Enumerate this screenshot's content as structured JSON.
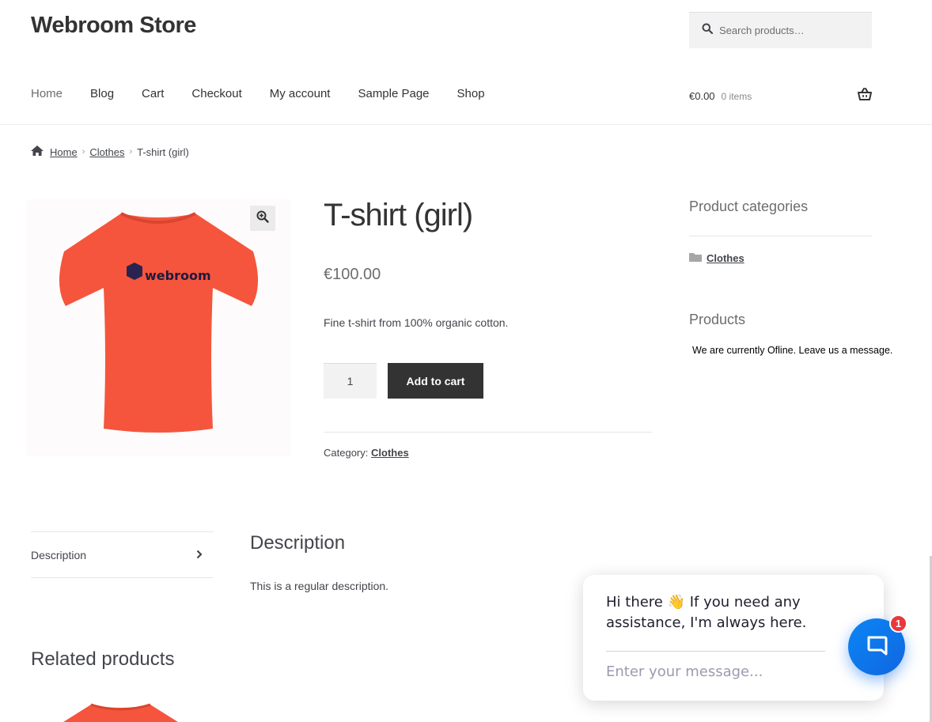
{
  "header": {
    "site_title": "Webroom Store",
    "search_placeholder": "Search products…",
    "nav": [
      "Home",
      "Blog",
      "Cart",
      "Checkout",
      "My account",
      "Sample Page",
      "Shop"
    ],
    "cart_amount": "€0.00",
    "cart_count": "0 items"
  },
  "breadcrumb": {
    "home": "Home",
    "category": "Clothes",
    "current": "T-shirt (girl)"
  },
  "product": {
    "image_brand": "webroom",
    "title": "T-shirt (girl)",
    "price": "€100.00",
    "short_description": "Fine t-shirt from 100% organic cotton.",
    "quantity": "1",
    "add_to_cart_label": "Add to cart",
    "category_label": "Category:",
    "category_value": "Clothes"
  },
  "sidebar": {
    "categories_title": "Product categories",
    "categories": [
      "Clothes"
    ],
    "products_title": "Products",
    "offline_message": "We are currently Ofline. Leave us a message."
  },
  "tabs": {
    "description_tab": "Description",
    "description_heading": "Description",
    "description_text": "This is a regular description."
  },
  "related": {
    "heading": "Related products"
  },
  "chat": {
    "greeting_line1": "Hi there 👋 If you need any",
    "greeting_line2": "assistance, I'm always here.",
    "input_placeholder": "Enter your message...",
    "badge_count": "1"
  },
  "colors": {
    "shirt": "#f5553d",
    "dark_button": "#333333",
    "chat_blue": "#0a86f5",
    "badge_red": "#e8383d"
  }
}
